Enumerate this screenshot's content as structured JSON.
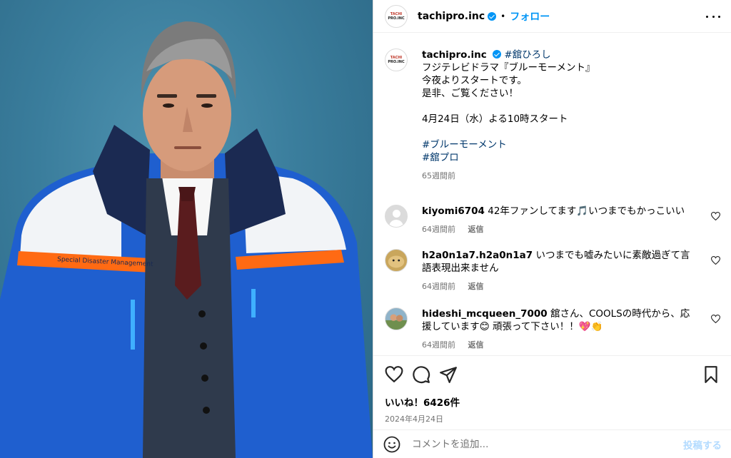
{
  "post": {
    "username": "tachipro.inc",
    "separator": "•",
    "follow_label": "フォロー",
    "avatar_logo_line1": "TACHI",
    "avatar_logo_line2": "PRO.INC"
  },
  "caption": {
    "username": "tachipro.inc",
    "hashtag_inline": "#舘ひろし",
    "lines": [
      "フジテレビドラマ『ブルーモーメント』",
      "今夜よりスタートです。",
      "是非、ご覧ください！"
    ],
    "schedule": "4月24日（水）よる10時スタート",
    "hashtags": [
      "#ブルーモーメント",
      "#舘プロ"
    ],
    "time": "65週間前"
  },
  "comments": [
    {
      "username": "kiyomi6704",
      "text": "42年ファンしてます🎵いつまでもかっこいい",
      "time": "64週間前",
      "reply": "返信"
    },
    {
      "username": "h2a0n1a7.h2a0n1a7",
      "text": "いつまでも嘘みたいに素敵過ぎて言語表現出来ません",
      "time": "64週間前",
      "reply": "返信"
    },
    {
      "username": "hideshi_mcqueen_7000",
      "text": "舘さん、COOLSの時代から、応援しています😊 頑張って下さい！！💖👏",
      "time": "64週間前",
      "reply": "返信"
    }
  ],
  "photo": {
    "jacket_text": "Special Disaster Management"
  },
  "stats": {
    "likes": "いいね！6426件",
    "date": "2024年4月24日"
  },
  "composer": {
    "placeholder": "コメントを追加...",
    "post_label": "投稿する"
  },
  "colors": {
    "accent": "#0095f6",
    "background_photo": "#3a7d9c",
    "jacket_blue": "#1e5fd0",
    "jacket_orange": "#ff6a13"
  }
}
